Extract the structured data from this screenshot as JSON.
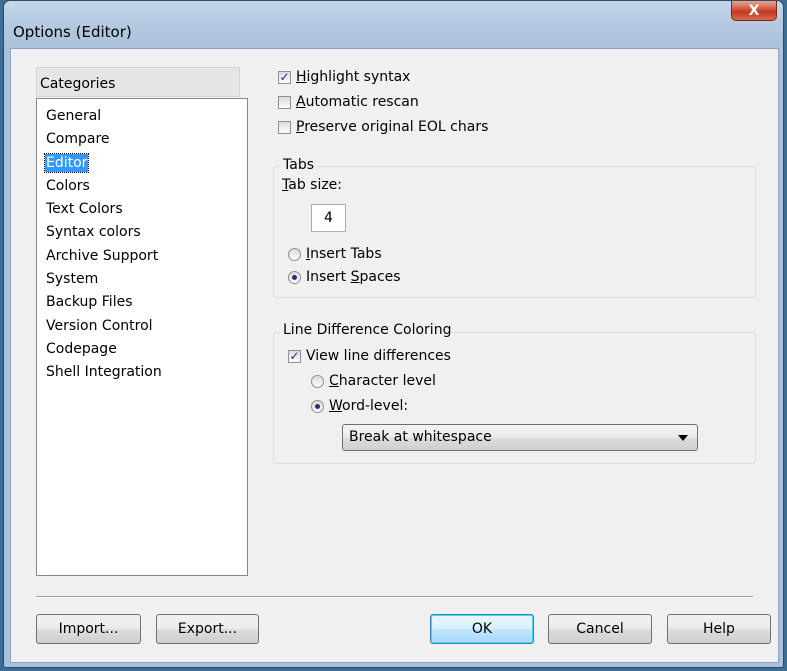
{
  "window": {
    "title": "Options (Editor)",
    "close_label": "X"
  },
  "categories": {
    "header": "Categories",
    "items": [
      "General",
      "Compare",
      "Editor",
      "Colors",
      "Text Colors",
      "Syntax colors",
      "Archive Support",
      "System",
      "Backup Files",
      "Version Control",
      "Codepage",
      "Shell Integration"
    ],
    "selected": "Editor"
  },
  "editor_options": {
    "highlight_syntax": {
      "prefix": "",
      "accel": "H",
      "rest": "ighlight syntax",
      "checked": true
    },
    "automatic_rescan": {
      "prefix": "",
      "accel": "A",
      "rest": "utomatic rescan",
      "checked": false
    },
    "preserve_eol": {
      "prefix": "",
      "accel": "P",
      "rest": "reserve original EOL chars",
      "checked": false
    }
  },
  "tabs_group": {
    "label": "Tabs",
    "tab_size_accel": "T",
    "tab_size_rest": "ab size:",
    "tab_size_value": "4",
    "insert_tabs": {
      "accel": "I",
      "rest": "nsert Tabs",
      "selected": false
    },
    "insert_spaces": {
      "prefix": "Insert ",
      "accel": "S",
      "rest": "paces",
      "selected": true
    }
  },
  "line_diff_group": {
    "label": "Line Difference Coloring",
    "view_line_diffs": {
      "label": "View line differences",
      "checked": true
    },
    "character_level": {
      "accel": "C",
      "rest": "haracter level",
      "selected": false
    },
    "word_level": {
      "accel": "W",
      "rest": "ord-level:",
      "selected": true
    },
    "word_break_value": "Break at whitespace"
  },
  "buttons": {
    "import": "Import...",
    "export": "Export...",
    "ok": "OK",
    "cancel": "Cancel",
    "help": "Help"
  }
}
